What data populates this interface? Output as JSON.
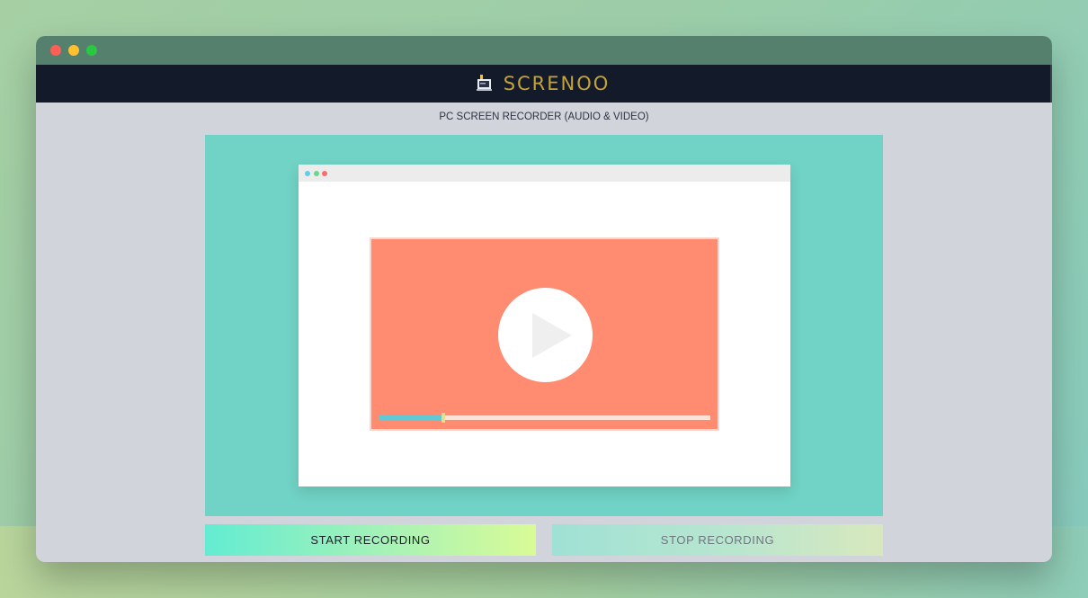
{
  "app": {
    "brand": "SCRENOO",
    "subtitle": "PC SCREEN RECORDER (AUDIO & VIDEO)"
  },
  "window": {
    "controls": [
      "close",
      "minimize",
      "maximize"
    ]
  },
  "preview": {
    "play_icon": "play-icon",
    "progress": 0.19
  },
  "actions": {
    "start_label": "START RECORDING",
    "stop_label": "STOP RECORDING"
  },
  "colors": {
    "brand": "#c6a338",
    "appbar": "#131a29",
    "stage": "#70d3c5",
    "player": "#ff8c71"
  }
}
